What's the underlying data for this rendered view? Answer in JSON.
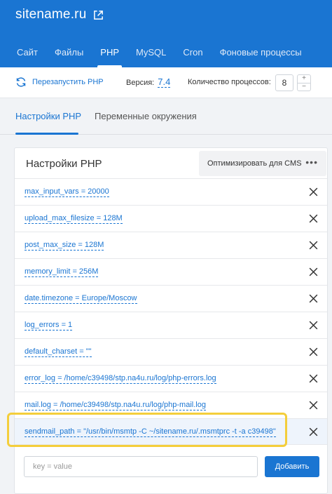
{
  "site": {
    "name": "sitename.ru"
  },
  "tabs": [
    {
      "label": "Сайт",
      "active": false
    },
    {
      "label": "Файлы",
      "active": false
    },
    {
      "label": "PHP",
      "active": true
    },
    {
      "label": "MySQL",
      "active": false
    },
    {
      "label": "Cron",
      "active": false
    },
    {
      "label": "Фоновые процессы",
      "active": false
    }
  ],
  "toolbar": {
    "restart_label": "Перезапустить PHP",
    "version_label": "Версия:",
    "version_value": "7.4",
    "processes_label": "Количество процессов:",
    "processes_value": "8",
    "plus": "+",
    "minus": "−"
  },
  "subtabs": [
    {
      "label": "Настройки PHP",
      "active": true
    },
    {
      "label": "Переменные окружения",
      "active": false
    }
  ],
  "card": {
    "title": "Настройки PHP",
    "optimize_label": "Оптимизировать для CMS",
    "more": "•••",
    "settings": [
      "max_input_vars = 20000",
      "upload_max_filesize = 128M",
      "post_max_size = 128M",
      "memory_limit = 256M",
      "date.timezone = Europe/Moscow",
      "log_errors = 1",
      "default_charset = \"\"",
      "error_log = /home/c39498/stp.na4u.ru/log/php-errors.log",
      "mail.log = /home/c39498/stp.na4u.ru/log/php-mail.log",
      "sendmail_path = \"/usr/bin/msmtp -C ~/sitename.ru/.msmtprc -t -a c39498\""
    ],
    "new_entry_placeholder": "key = value",
    "add_label": "Добавить"
  },
  "colors": {
    "accent": "#1a75d2",
    "highlight": "#f4ce3b"
  }
}
